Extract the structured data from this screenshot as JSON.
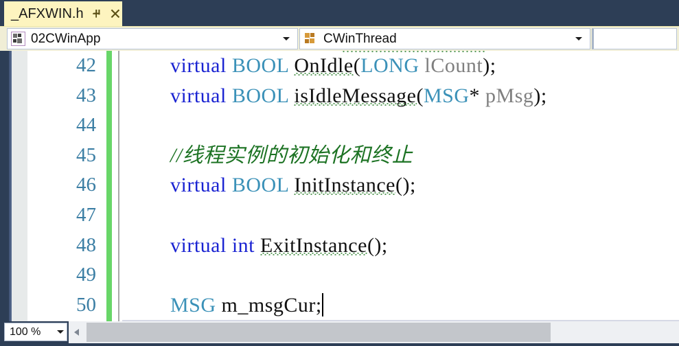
{
  "window": {
    "theme_background": "#2d3e56",
    "accent_tab": "#fdf4bf"
  },
  "tab": {
    "title": "_AFXWIN.h",
    "pin_icon": "pin-icon",
    "close_icon": "close-icon",
    "close_label": "×"
  },
  "navbar": {
    "project_combo": {
      "value": "02CWinApp",
      "icon": "class-icon",
      "arrow": "chevron-down-icon"
    },
    "member_combo": {
      "value": "CWinThread",
      "icon": "class-icon",
      "arrow": "chevron-down-icon"
    },
    "third_combo": {
      "value": "",
      "arrow": "chevron-down-icon"
    }
  },
  "editor": {
    "line_numbers": [
      "42",
      "43",
      "44",
      "45",
      "46",
      "47",
      "48",
      "49",
      "50"
    ],
    "change_indicator_color": "#68d668",
    "colors": {
      "keyword": "#1a23d2",
      "type": "#3b91b8",
      "identifier": "#111111",
      "parameter": "#7f7f7f",
      "comment": "#1d7324",
      "line_number": "#3b7ea4",
      "squiggle": "#5b9c5b"
    },
    "lines": [
      {
        "number": "42",
        "tokens": [
          {
            "t": "virtual",
            "k": "kw"
          },
          {
            "t": " ",
            "k": "punct"
          },
          {
            "t": "BOOL",
            "k": "type"
          },
          {
            "t": " ",
            "k": "punct"
          },
          {
            "t": "OnIdle",
            "k": "ident",
            "squiggle": true
          },
          {
            "t": "(",
            "k": "punct"
          },
          {
            "t": "LONG",
            "k": "type"
          },
          {
            "t": " ",
            "k": "punct"
          },
          {
            "t": "lCount",
            "k": "param"
          },
          {
            "t": ");",
            "k": "punct"
          }
        ]
      },
      {
        "number": "43",
        "tokens": [
          {
            "t": "virtual",
            "k": "kw"
          },
          {
            "t": " ",
            "k": "punct"
          },
          {
            "t": "BOOL",
            "k": "type"
          },
          {
            "t": " ",
            "k": "punct"
          },
          {
            "t": "isIdleMessage",
            "k": "ident",
            "squiggle": true
          },
          {
            "t": "(",
            "k": "punct"
          },
          {
            "t": "MSG",
            "k": "type"
          },
          {
            "t": "* ",
            "k": "punct"
          },
          {
            "t": "pMsg",
            "k": "param"
          },
          {
            "t": ");",
            "k": "punct"
          }
        ]
      },
      {
        "number": "44",
        "tokens": []
      },
      {
        "number": "45",
        "tokens": [
          {
            "t": "//线程实例的初始化和终止",
            "k": "comment"
          }
        ]
      },
      {
        "number": "46",
        "tokens": [
          {
            "t": "virtual",
            "k": "kw"
          },
          {
            "t": " ",
            "k": "punct"
          },
          {
            "t": "BOOL",
            "k": "type"
          },
          {
            "t": " ",
            "k": "punct"
          },
          {
            "t": "InitInstance",
            "k": "ident",
            "squiggle": true
          },
          {
            "t": "();",
            "k": "punct"
          }
        ]
      },
      {
        "number": "47",
        "tokens": []
      },
      {
        "number": "48",
        "tokens": [
          {
            "t": "virtual",
            "k": "kw"
          },
          {
            "t": " ",
            "k": "punct"
          },
          {
            "t": "int",
            "k": "kw"
          },
          {
            "t": " ",
            "k": "punct"
          },
          {
            "t": "ExitInstance",
            "k": "ident",
            "squiggle": true
          },
          {
            "t": "();",
            "k": "punct"
          }
        ]
      },
      {
        "number": "49",
        "tokens": []
      },
      {
        "number": "50",
        "current": true,
        "tokens": [
          {
            "t": "MSG",
            "k": "type"
          },
          {
            "t": " ",
            "k": "punct"
          },
          {
            "t": "m_msgCur",
            "k": "ident"
          },
          {
            "t": ";",
            "k": "punct"
          },
          {
            "t": "",
            "k": "caret"
          }
        ]
      }
    ]
  },
  "statusbar": {
    "zoom": {
      "value": "100 %",
      "arrow": "chevron-down-icon"
    },
    "hscroll": {
      "left_arrow": "scroll-left-arrow-icon"
    }
  }
}
